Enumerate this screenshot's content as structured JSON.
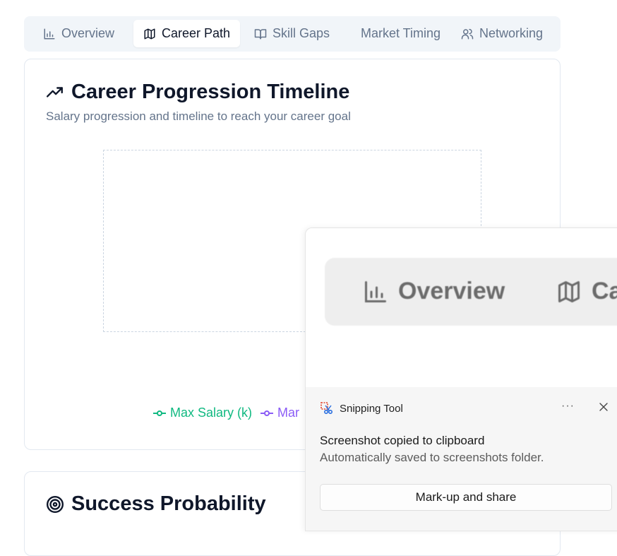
{
  "tabs": [
    {
      "label": "Overview",
      "icon": "bar-chart-icon",
      "active": false
    },
    {
      "label": "Career Path",
      "icon": "map-icon",
      "active": true
    },
    {
      "label": "Skill Gaps",
      "icon": "book-open-icon",
      "active": false
    },
    {
      "label": "Market Timing",
      "icon": "",
      "active": false
    },
    {
      "label": "Networking",
      "icon": "users-icon",
      "active": false
    }
  ],
  "timeline_card": {
    "title": "Career Progression Timeline",
    "subtitle": "Salary progression and timeline to reach your career goal",
    "legend": [
      {
        "label": "Max Salary (k)",
        "color": "#10b981"
      },
      {
        "label": "Mar",
        "color": "#8b5cf6"
      }
    ]
  },
  "success_card": {
    "title": "Success Probability"
  },
  "snip": {
    "preview_tabs": [
      "Overview",
      "Ca"
    ],
    "app_name": "Snipping Tool",
    "more_label": "···",
    "title": "Screenshot copied to clipboard",
    "message": "Automatically saved to screenshots folder.",
    "button": "Mark-up and share"
  },
  "colors": {
    "accent_green": "#10b981",
    "accent_purple": "#8b5cf6",
    "muted": "#64748b"
  }
}
